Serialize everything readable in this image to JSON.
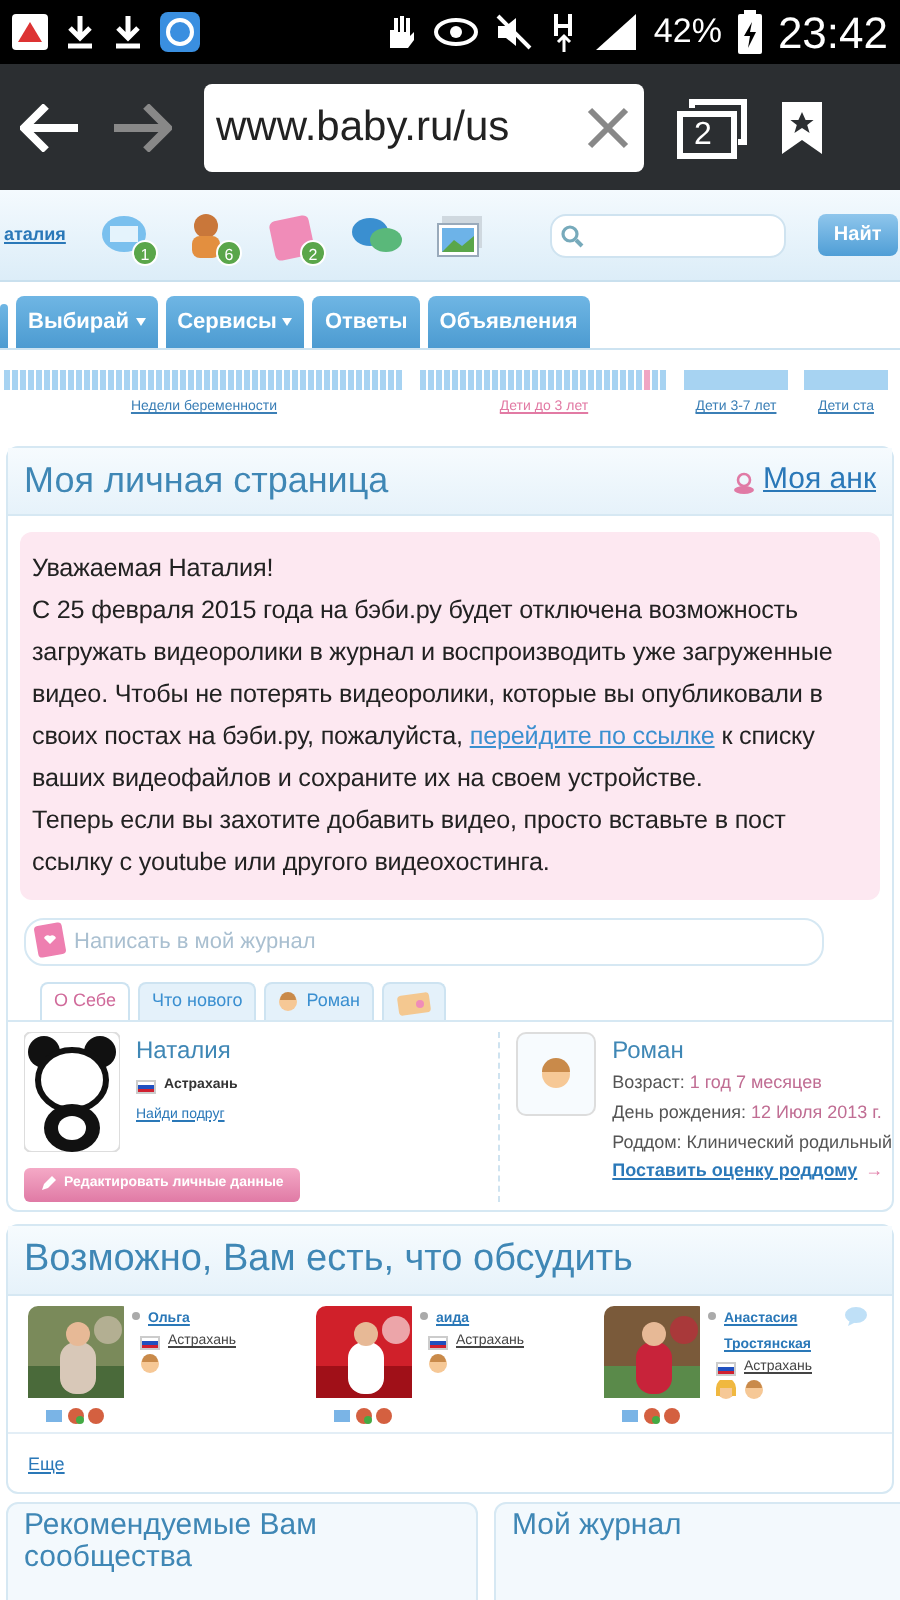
{
  "status_bar": {
    "battery": "42%",
    "time": "23:42"
  },
  "browser": {
    "url": "www.baby.ru/us",
    "tab_count": "2"
  },
  "header": {
    "user": "аталия",
    "icons": [
      {
        "kind": "mail",
        "count": "1"
      },
      {
        "kind": "friends",
        "count": "6"
      },
      {
        "kind": "gifts",
        "count": "2"
      },
      {
        "kind": "chat"
      },
      {
        "kind": "photos"
      }
    ],
    "search_button": "Найт"
  },
  "nav": [
    {
      "label": "Выбирай",
      "dropdown": true
    },
    {
      "label": "Сервисы",
      "dropdown": true
    },
    {
      "label": "Ответы",
      "dropdown": false
    },
    {
      "label": "Объявления",
      "dropdown": false
    }
  ],
  "timeline": [
    {
      "label": "Недели беременности",
      "selected": false,
      "kind": "ticks"
    },
    {
      "label": "Дети до 3 лет",
      "selected": true,
      "kind": "ticks",
      "level": 0.93
    },
    {
      "label": "Дети 3-7 лет",
      "selected": false,
      "kind": "solid"
    },
    {
      "label": "Дети ста",
      "selected": false,
      "kind": "solid"
    }
  ],
  "page": {
    "title": "Моя личная страница",
    "profile_link": "Моя анк",
    "notice": {
      "greeting": "Уважаемая Наталия!",
      "before_link": "С 25 февраля 2015 года на бэби.ру будет отключена возможность загружать видеоролики в журнал и воспроизводить уже загруженные видео. Чтобы не потерять видеоролики, которые вы опубликовали в своих постах на бэби.ру, пожалуйста, ",
      "link": "перейдите по ссылке",
      "after_link": " к списку ваших видеофайлов и сохраните их на своем устройстве.",
      "footer": "Теперь если вы захотите добавить видео, просто вставьте в пост ссылку с youtube или другого видеохостинга."
    },
    "journal_placeholder": "Написать в мой журнал",
    "tabs": [
      {
        "kind": "text",
        "label": "О Себе",
        "selected": true
      },
      {
        "kind": "text",
        "label": "Что нового",
        "selected": false
      },
      {
        "kind": "child",
        "label": "Роман",
        "selected": false
      },
      {
        "kind": "icon",
        "selected": false
      }
    ],
    "profile": {
      "name": "Наталия",
      "city": "Астрахань",
      "link": "Найди подруг",
      "edit_button": "Редактировать личные данные"
    },
    "child": {
      "name": "Роман",
      "rows": [
        {
          "label": "Возраст:",
          "value": "1 год 7 месяцев",
          "accent": true
        },
        {
          "label": "День рождения:",
          "value": "12 Июля 2013 г.",
          "accent": true
        },
        {
          "label": "Роддом:",
          "value": "Клинический родильный",
          "accent": false
        }
      ],
      "link": "Поставить оценку роддому",
      "arrow": "→"
    }
  },
  "suggest": {
    "title": "Возможно, Вам есть, что обсудить",
    "people": [
      {
        "name": "Ольга",
        "city": "Астрахань",
        "kids": [
          {
            "kind": "boy"
          }
        ],
        "bubble": false
      },
      {
        "name": "аида",
        "city": "Астрахань",
        "kids": [
          {
            "kind": "boy"
          }
        ],
        "bubble": false
      },
      {
        "name": "Анастасия Тростянская",
        "city": "Астрахань",
        "kids": [
          {
            "kind": "girl"
          },
          {
            "kind": "boy"
          }
        ],
        "bubble": true
      }
    ],
    "more": "Еще"
  },
  "bottom": [
    "Рекомендуемые Вам сообщества",
    "Мой журнал"
  ]
}
